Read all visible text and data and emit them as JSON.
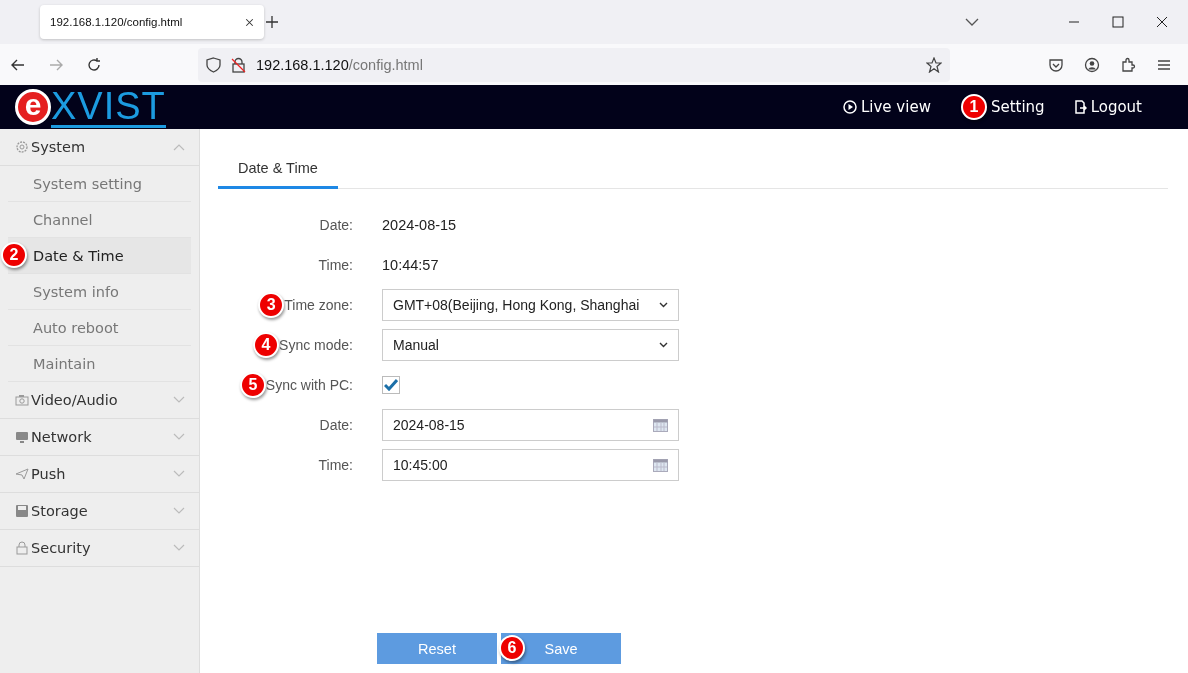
{
  "browser": {
    "tab_title": "192.168.1.120/config.html",
    "url_host": "192.168.1.120",
    "url_path": "/config.html"
  },
  "header": {
    "logo_mark": "e",
    "logo_text": "XVIST",
    "nav": [
      {
        "label": "Live view"
      },
      {
        "label": "Setting",
        "badge": "1"
      },
      {
        "label": "Logout"
      }
    ]
  },
  "sidebar": {
    "groups": [
      {
        "label": "System",
        "expanded": true,
        "children": [
          {
            "label": "System setting",
            "selected": false
          },
          {
            "label": "Channel",
            "selected": false
          },
          {
            "label": "Date & Time",
            "selected": true,
            "badge": "2"
          },
          {
            "label": "System info",
            "selected": false
          },
          {
            "label": "Auto reboot",
            "selected": false
          },
          {
            "label": "Maintain",
            "selected": false
          }
        ]
      },
      {
        "label": "Video/Audio",
        "expanded": false
      },
      {
        "label": "Network",
        "expanded": false
      },
      {
        "label": "Push",
        "expanded": false
      },
      {
        "label": "Storage",
        "expanded": false
      },
      {
        "label": "Security",
        "expanded": false
      }
    ]
  },
  "tabs": [
    {
      "label": "Date & Time",
      "selected": true
    }
  ],
  "form": [
    {
      "kind": "text",
      "label": "Date:",
      "value": "2024-08-15"
    },
    {
      "kind": "text",
      "label": "Time:",
      "value": "10:44:57"
    },
    {
      "kind": "select",
      "label": "Time zone:",
      "value": "GMT+08(Beijing, Hong Kong, Shanghai",
      "badge": "3"
    },
    {
      "kind": "select",
      "label": "Sync mode:",
      "value": "Manual",
      "badge": "4"
    },
    {
      "kind": "checkbox",
      "label": "Sync with PC:",
      "checked": true,
      "badge": "5"
    },
    {
      "kind": "datefield",
      "label": "Date:",
      "value": "2024-08-15"
    },
    {
      "kind": "datefield",
      "label": "Time:",
      "value": "10:45:00"
    }
  ],
  "buttons": [
    {
      "label": "Reset"
    },
    {
      "label": "Save",
      "badge": "6"
    }
  ]
}
